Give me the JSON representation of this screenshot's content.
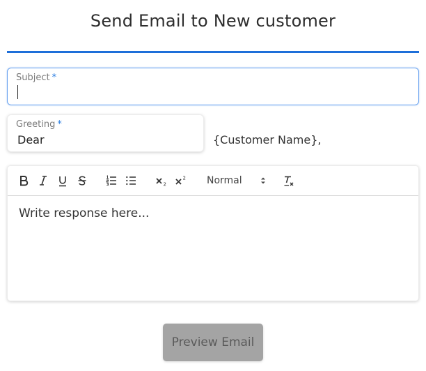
{
  "header": {
    "title": "Send Email to New customer"
  },
  "form": {
    "subject": {
      "label": "Subject",
      "required_mark": "*",
      "value": ""
    },
    "greeting": {
      "label": "Greeting",
      "required_mark": "*",
      "value": "Dear"
    },
    "greeting_suffix": "{Customer Name},",
    "editor": {
      "toolbar": {
        "bold_label": "B",
        "italic_label": "I",
        "underline_label": "U",
        "strike_label": "S",
        "format_select_value": "Normal",
        "icons": [
          "bold-icon",
          "italic-icon",
          "underline-icon",
          "strikethrough-icon",
          "ordered-list-icon",
          "bullet-list-icon",
          "subscript-icon",
          "superscript-icon",
          "clear-format-icon"
        ]
      },
      "placeholder": "Write response here..."
    },
    "preview_button_label": "Preview Email"
  },
  "colors": {
    "accent": "#1e6fd9",
    "required": "#2a7de1",
    "button_disabled_bg": "#a4a4a4"
  }
}
